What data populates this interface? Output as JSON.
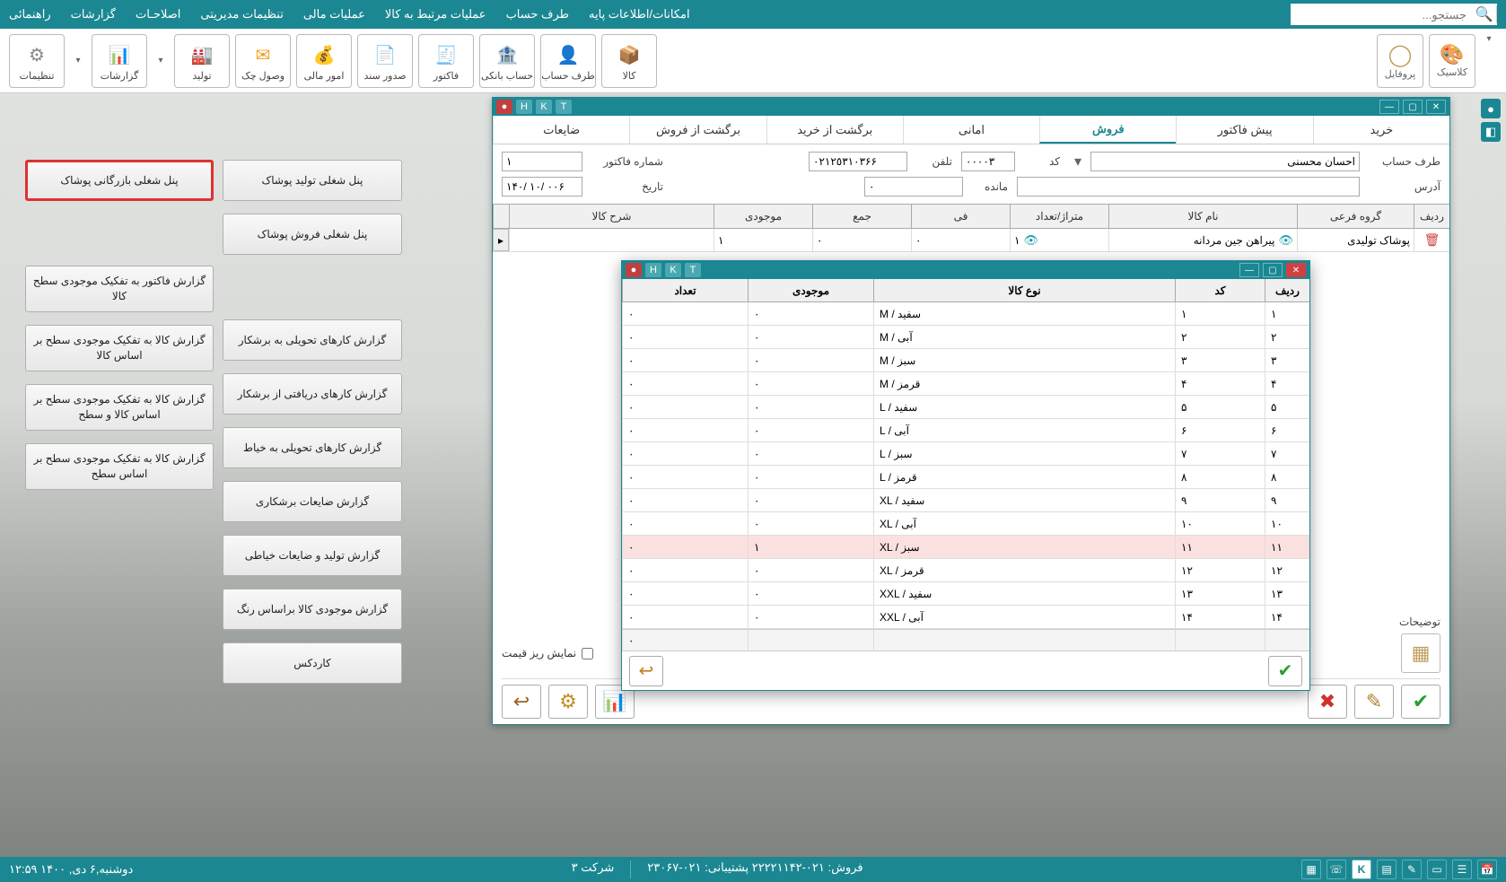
{
  "menubar": {
    "items": [
      "امکانات/اطلاعات پایه",
      "طرف حساب",
      "عملیات مرتبط به کالا",
      "عملیات مالی",
      "تنظیمات مدیریتی",
      "اصلاحـات",
      "گزارشات",
      "راهنمائی"
    ]
  },
  "search": {
    "placeholder": "جستجو..."
  },
  "toolbar": {
    "items": [
      {
        "label": "کالا",
        "key": "kala"
      },
      {
        "label": "طرف حساب",
        "key": "taraf"
      },
      {
        "label": "حساب بانکی",
        "key": "bank"
      },
      {
        "label": "فاکتور",
        "key": "invoice"
      },
      {
        "label": "صدور سند",
        "key": "sanad"
      },
      {
        "label": "امور مالی",
        "key": "finance"
      },
      {
        "label": "وصول چک",
        "key": "cheque"
      },
      {
        "label": "تولید",
        "key": "production"
      },
      {
        "label": "گزارشات",
        "key": "reports"
      },
      {
        "label": "تنظیمات",
        "key": "settings"
      }
    ],
    "profile": "پروفایل",
    "classic": "کلاسیک"
  },
  "panel_buttons_col1": [
    "پنل شغلی بازرگانی پوشاک",
    "گزارش فاکتور به تفکیک موجودی سطح کالا",
    "گزارش کالا به تفکیک موجودی سطح بر اساس کالا",
    "گزارش کالا به تفکیک موجودی سطح بر اساس کالا و سطح",
    "گزارش کالا به تفکیک موجودی سطح بر اساس سطح"
  ],
  "panel_buttons_col2": [
    "پنل شغلی تولید پوشاک",
    "پنل شغلی فروش پوشاک",
    "گزارش کارهای تحویلی به برشکار",
    "گزارش کارهای دریافتی از برشکار",
    "گزارش کارهای تحویلی به خیاط",
    "گزارش ضایعات برشکاری",
    "گزارش تولید و ضایعات خیاطی",
    "گزارش موجودی کالا براساس رنگ",
    "کاردکس"
  ],
  "main_window": {
    "title_buttons": [
      "T",
      "K",
      "H"
    ],
    "tabs": [
      "خرید",
      "پیش فاکتور",
      "فروش",
      "امانی",
      "برگشت از خرید",
      "برگشت از فروش",
      "ضایعات"
    ],
    "active_tab": 2,
    "fields": {
      "taraf_label": "طرف حساب",
      "taraf_value": "احسان محسنی",
      "kod_label": "کد",
      "kod_value": "٠٠٠٠٣",
      "tel_label": "تلفن",
      "tel_value": "٠٢١٢٥٣١٠٣۶۶",
      "shomare_label": "شماره فاکتور",
      "shomare_value": "١",
      "addr_label": "آدرس",
      "addr_value": "",
      "mande_label": "مانده",
      "mande_value": "٠",
      "date_label": "تاریخ",
      "date_value": "١۴٠٠ /١٠ /٠۶"
    },
    "grid_headers": [
      "ردیف",
      "گروه فرعی",
      "نام کالا",
      "متراژ/تعداد",
      "فی",
      "جمع",
      "موجودی",
      "شرح کالا"
    ],
    "grid_row": {
      "group": "پوشاک تولیدی",
      "name": "پیراهن جین مردانه",
      "qty": "١",
      "fee": "٠",
      "sum": "٠",
      "stock": "١"
    },
    "desc_label": "توضیحات",
    "checkbox_label": "نمایش ریز قیمت"
  },
  "popup": {
    "headers": [
      "ردیف",
      "کد",
      "نوع کالا",
      "موجودی",
      "تعداد"
    ],
    "rows": [
      {
        "row": "١",
        "code": "١",
        "type": "M / سفید",
        "stock": "٠",
        "qty": "٠"
      },
      {
        "row": "٢",
        "code": "٢",
        "type": "M / آبی",
        "stock": "٠",
        "qty": "٠"
      },
      {
        "row": "٣",
        "code": "٣",
        "type": "M / سبز",
        "stock": "٠",
        "qty": "٠"
      },
      {
        "row": "۴",
        "code": "۴",
        "type": "M / قرمز",
        "stock": "٠",
        "qty": "٠"
      },
      {
        "row": "۵",
        "code": "۵",
        "type": "L / سفید",
        "stock": "٠",
        "qty": "٠"
      },
      {
        "row": "۶",
        "code": "۶",
        "type": "L / آبی",
        "stock": "٠",
        "qty": "٠"
      },
      {
        "row": "٧",
        "code": "٧",
        "type": "L / سبز",
        "stock": "٠",
        "qty": "٠"
      },
      {
        "row": "٨",
        "code": "٨",
        "type": "L / قرمز",
        "stock": "٠",
        "qty": "٠"
      },
      {
        "row": "٩",
        "code": "٩",
        "type": "XL / سفید",
        "stock": "٠",
        "qty": "٠"
      },
      {
        "row": "١٠",
        "code": "١٠",
        "type": "XL / آبی",
        "stock": "٠",
        "qty": "٠"
      },
      {
        "row": "١١",
        "code": "١١",
        "type": "XL / سبز",
        "stock": "١",
        "qty": "٠",
        "selected": true
      },
      {
        "row": "١٢",
        "code": "١٢",
        "type": "XL / قرمز",
        "stock": "٠",
        "qty": "٠"
      },
      {
        "row": "١٣",
        "code": "١٣",
        "type": "XXL / سفید",
        "stock": "٠",
        "qty": "٠"
      },
      {
        "row": "١۴",
        "code": "١۴",
        "type": "XXL / آبی",
        "stock": "٠",
        "qty": "٠"
      }
    ],
    "sum_qty": "٠"
  },
  "statusbar": {
    "datetime": "دوشنبه,۶ دی, ١۴٠٠   ١٢:۵٩",
    "company": "شرکت ٣",
    "support": "٠٢١-٢٢٢٢١١۴٢ پشتیبانی: ٠٢١-٢٣٠۶٧",
    "sale_label": "فروش:"
  }
}
